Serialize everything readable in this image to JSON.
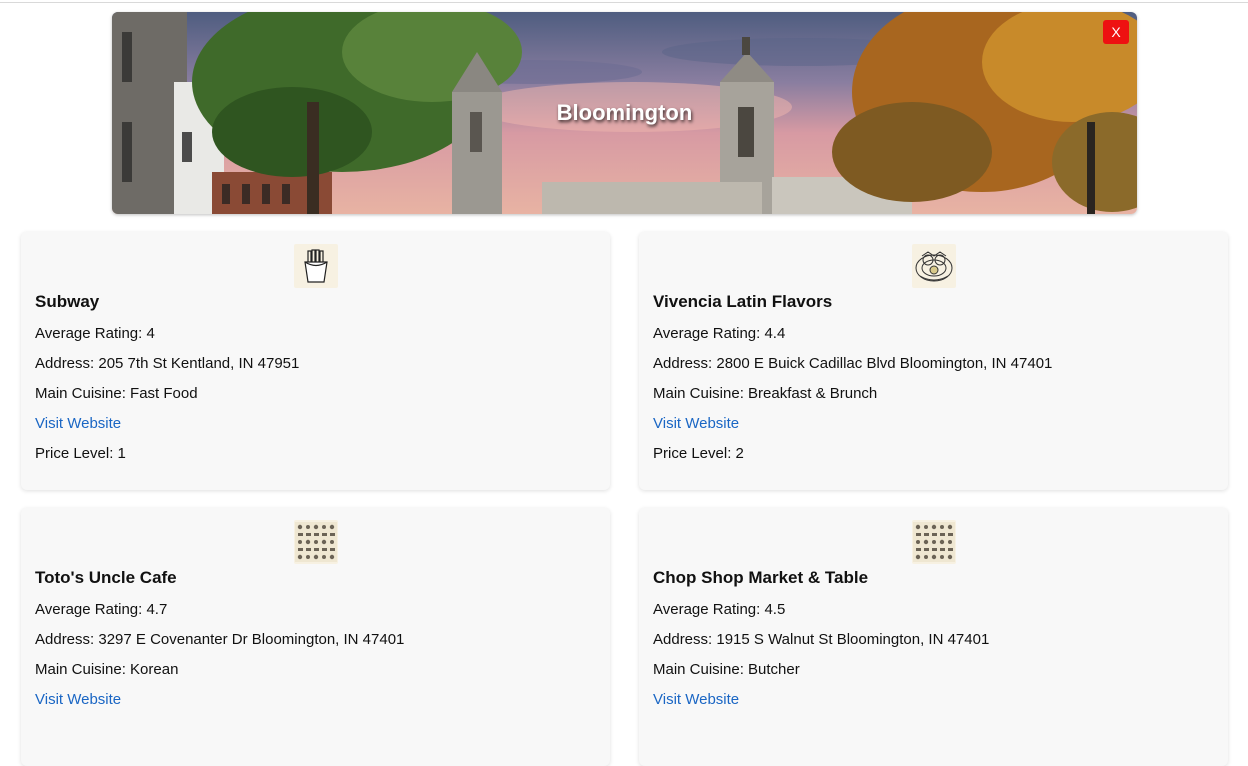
{
  "hero": {
    "title": "Bloomington",
    "close_label": "X"
  },
  "restaurants": [
    {
      "name": "Subway",
      "icon": "fries-icon",
      "rating_label": "Average Rating: 4",
      "address_label": "Address: 205 7th St Kentland, IN 47951",
      "cuisine_label": "Main Cuisine: Fast Food",
      "website_label": "Visit Website",
      "price_label": "Price Level: 1"
    },
    {
      "name": "Vivencia Latin Flavors",
      "icon": "breakfast-plate-icon",
      "rating_label": "Average Rating: 4.4",
      "address_label": "Address: 2800 E Buick Cadillac Blvd Bloomington, IN 47401",
      "cuisine_label": "Main Cuisine: Breakfast & Brunch",
      "website_label": "Visit Website",
      "price_label": "Price Level: 2"
    },
    {
      "name": "Toto's Uncle Cafe",
      "icon": "food-pattern-icon",
      "rating_label": "Average Rating: 4.7",
      "address_label": "Address: 3297 E Covenanter Dr Bloomington, IN 47401",
      "cuisine_label": "Main Cuisine: Korean",
      "website_label": "Visit Website",
      "price_label": ""
    },
    {
      "name": "Chop Shop Market & Table",
      "icon": "food-pattern-icon",
      "rating_label": "Average Rating: 4.5",
      "address_label": "Address: 1915 S Walnut St Bloomington, IN 47401",
      "cuisine_label": "Main Cuisine: Butcher",
      "website_label": "Visit Website",
      "price_label": ""
    }
  ],
  "colors": {
    "link": "#1a66c4",
    "close_button": "#ee1111",
    "card_background": "#f8f8f8"
  }
}
